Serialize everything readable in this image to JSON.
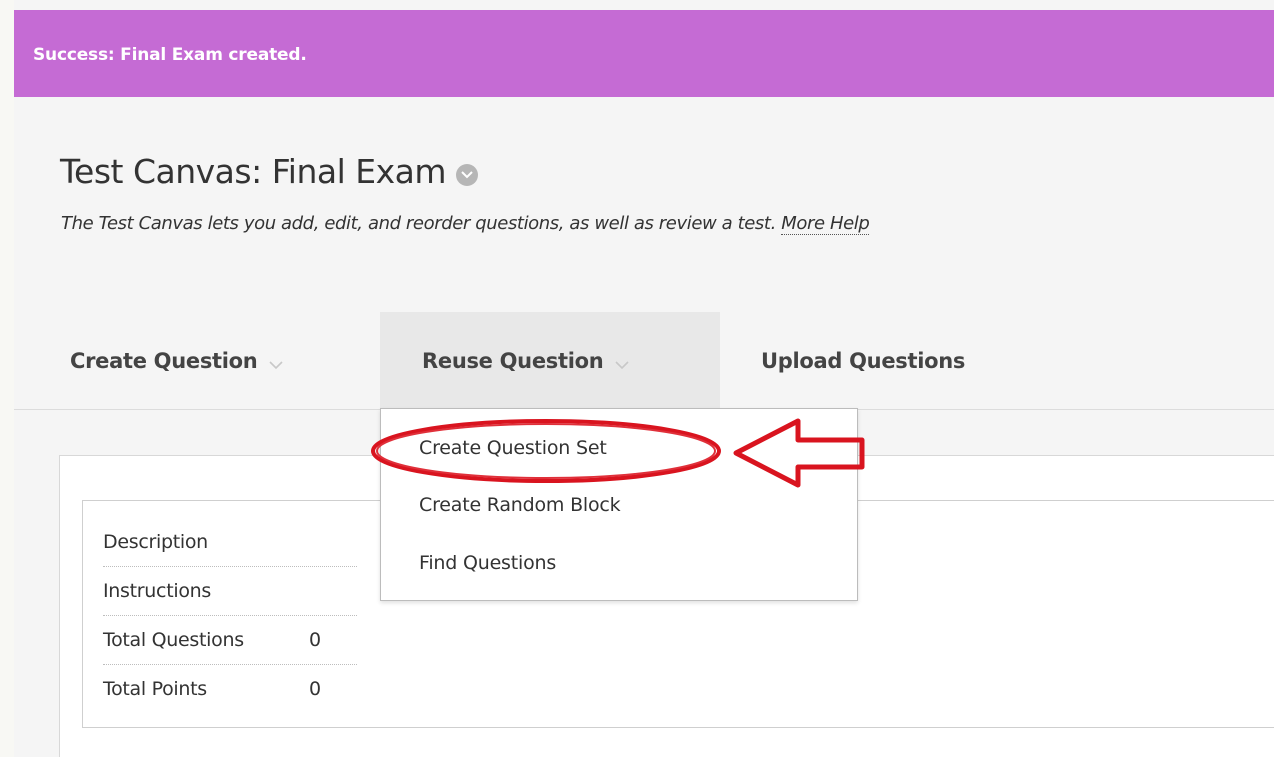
{
  "notification": {
    "message": "Success: Final Exam created."
  },
  "page": {
    "title": "Test Canvas: Final Exam",
    "description": "The Test Canvas lets you add, edit, and reorder questions, as well as review a test.",
    "help_link": "More Help"
  },
  "action_bar": {
    "create_question": "Create Question",
    "reuse_question": "Reuse Question",
    "upload_questions": "Upload Questions"
  },
  "reuse_menu": {
    "items": [
      {
        "label": "Create Question Set"
      },
      {
        "label": "Create Random Block"
      },
      {
        "label": "Find Questions"
      }
    ]
  },
  "test_info": {
    "rows": [
      {
        "label": "Description",
        "value": ""
      },
      {
        "label": "Instructions",
        "value": ""
      },
      {
        "label": "Total Questions",
        "value": "0"
      },
      {
        "label": "Total Points",
        "value": "0"
      }
    ]
  },
  "icons": {
    "title_options": "chevron-down-circle-icon",
    "menu_chevron": "chevron-down-icon",
    "annotation": "left-arrow-icon"
  },
  "colors": {
    "success_bar": "#c56bd4",
    "annotation_red": "#d9141f"
  }
}
